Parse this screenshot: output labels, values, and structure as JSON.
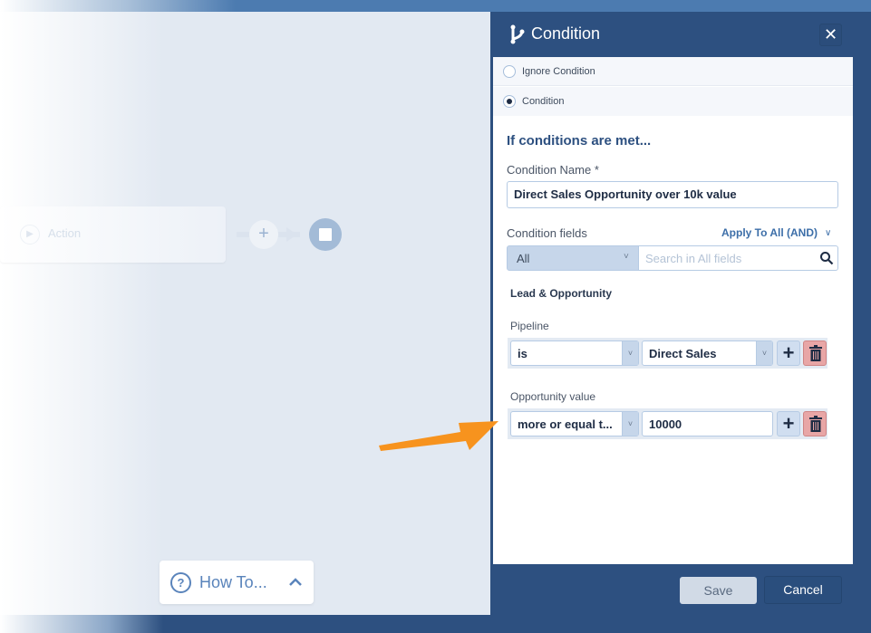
{
  "canvas": {
    "action_node": {
      "label": "Action",
      "icon": "play-icon"
    },
    "add_node": {
      "icon": "plus-icon",
      "glyph": "+"
    },
    "stop_node": {
      "icon": "stop-icon"
    },
    "how_to": {
      "label": "How To...",
      "icon": "question-circle-icon",
      "chevron": "chevron-up-icon",
      "help_glyph": "?"
    }
  },
  "panel": {
    "title": "Condition",
    "title_icon": "branch-icon",
    "close_glyph": "✕",
    "radios": [
      {
        "label": "Ignore Condition",
        "checked": false
      },
      {
        "label": "Condition",
        "checked": true
      }
    ],
    "section_title": "If conditions are met...",
    "condition_name": {
      "label": "Condition Name *",
      "value": "Direct Sales Opportunity over 10k value"
    },
    "condition_fields": {
      "label": "Condition fields",
      "apply_mode": "Apply To All (AND)",
      "apply_chevron": "∨",
      "filter_select": "All",
      "filter_chevron": "˅",
      "search_placeholder": "Search in All fields"
    },
    "group_title": "Lead & Opportunity",
    "conditions": [
      {
        "field": "Pipeline",
        "operator": "is",
        "value": "Direct Sales",
        "value_type": "select"
      },
      {
        "field": "Opportunity value",
        "operator": "more or equal t...",
        "value": "10000",
        "value_type": "input"
      }
    ],
    "add_glyph": "+",
    "chevron_glyph": "˅",
    "footer": {
      "save_label": "Save",
      "cancel_label": "Cancel"
    }
  },
  "annotation": {
    "type": "arrow",
    "color": "#f7931e"
  },
  "colors": {
    "panel_bg": "#2d5080",
    "accent": "#3c6ea8",
    "delete": "#e8a6a6",
    "canvas_bg": "#e2e9f2"
  }
}
